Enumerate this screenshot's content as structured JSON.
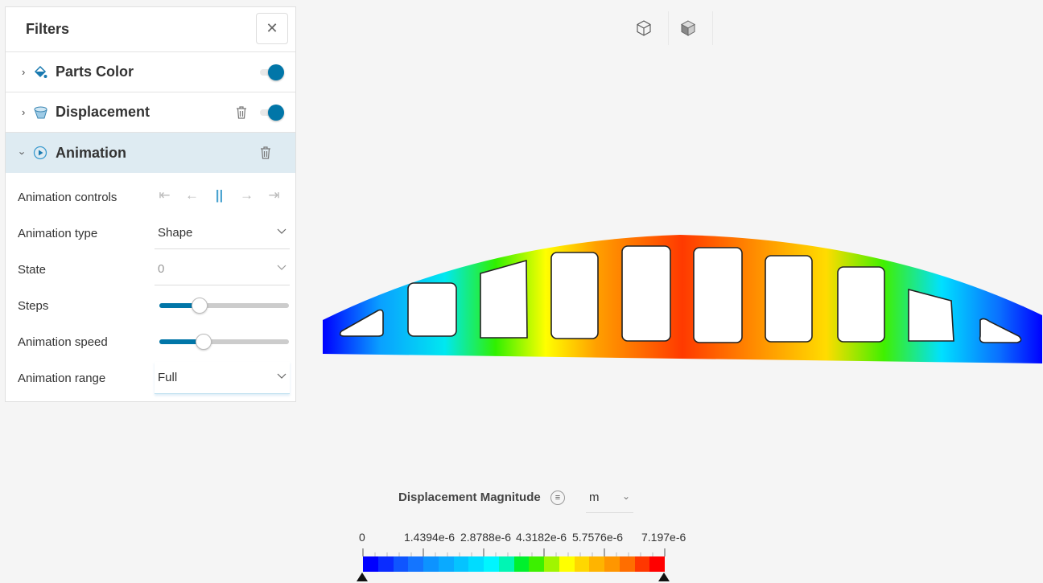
{
  "panel": {
    "title": "Filters",
    "filters": [
      {
        "label": "Parts Color",
        "icon": "paint-bucket-icon",
        "enabled": true,
        "expanded": false
      },
      {
        "label": "Displacement",
        "icon": "displacement-icon",
        "enabled": true,
        "expanded": false
      },
      {
        "label": "Animation",
        "icon": "play-circle-icon",
        "expanded": true
      }
    ],
    "animation": {
      "controls_label": "Animation controls",
      "type_label": "Animation type",
      "type_value": "Shape",
      "state_label": "State",
      "state_value": "0",
      "steps_label": "Steps",
      "steps_fraction": 0.31,
      "speed_label": "Animation speed",
      "speed_fraction": 0.34,
      "range_label": "Animation range",
      "range_value": "Full"
    }
  },
  "legend": {
    "title": "Displacement Magnitude",
    "unit": "m",
    "ticks": [
      "0",
      "1.4394e-6",
      "2.8788e-6",
      "4.3182e-6",
      "5.7576e-6",
      "7.197e-6"
    ],
    "colors": [
      "#0000ff",
      "#0a2cff",
      "#0f55ff",
      "#1475ff",
      "#0d93ff",
      "#0aaaff",
      "#05c3ff",
      "#00dcff",
      "#00f5ff",
      "#00f5b4",
      "#00f02d",
      "#3cf000",
      "#a0f500",
      "#ffff00",
      "#ffd700",
      "#ffb400",
      "#ff9600",
      "#ff6e00",
      "#ff3700",
      "#ff0000"
    ]
  }
}
